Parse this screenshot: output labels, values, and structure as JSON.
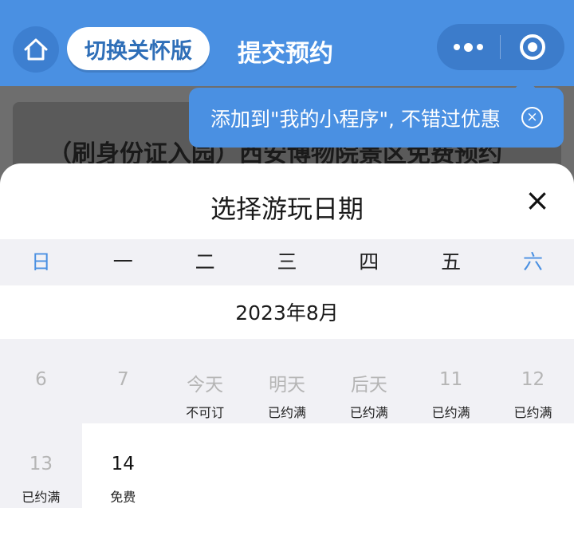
{
  "navbar": {
    "switch_label": "切换关怀版",
    "title": "提交预约",
    "home_icon": "home-icon",
    "more_icon": "more-dots-icon",
    "close_icon": "target-circle-icon",
    "bar_color": "#4a90e2"
  },
  "banner": {
    "text": "（刷身份证入园）西安博物院景区免费预约"
  },
  "tooltip": {
    "text": "添加到\"我的小程序\", 不错过优惠",
    "close_glyph": "×"
  },
  "sheet": {
    "title": "选择游玩日期",
    "close_glyph": "×",
    "weekdays": [
      "日",
      "一",
      "二",
      "三",
      "四",
      "五",
      "六"
    ],
    "month": "2023年8月",
    "days": [
      {
        "label": "6",
        "status": "",
        "available": false
      },
      {
        "label": "7",
        "status": "",
        "available": false
      },
      {
        "label": "今天",
        "status": "不可订",
        "available": false
      },
      {
        "label": "明天",
        "status": "已约满",
        "available": false
      },
      {
        "label": "后天",
        "status": "已约满",
        "available": false
      },
      {
        "label": "11",
        "status": "已约满",
        "available": false
      },
      {
        "label": "12",
        "status": "已约满",
        "available": false
      },
      {
        "label": "13",
        "status": "已约满",
        "available": false
      },
      {
        "label": "14",
        "status": "免费",
        "available": true
      }
    ]
  }
}
